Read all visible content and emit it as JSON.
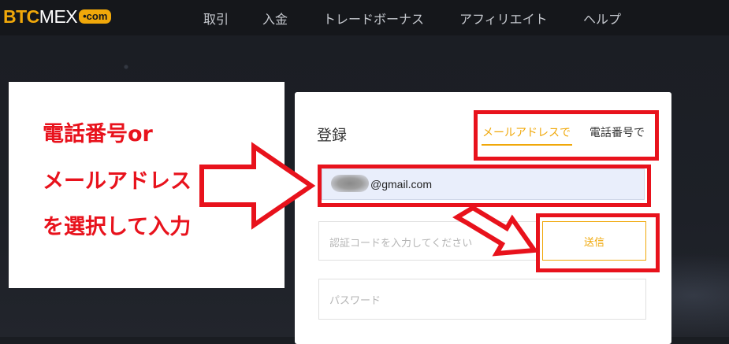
{
  "logo": {
    "btc": "BTC",
    "mex": "MEX",
    "com": "•com"
  },
  "nav": {
    "items": [
      {
        "label": "取引"
      },
      {
        "label": "入金"
      },
      {
        "label": "トレードボーナス"
      },
      {
        "label": "アフィリエイト"
      },
      {
        "label": "ヘルプ"
      }
    ]
  },
  "annotation": {
    "lines": [
      "電話番号or",
      "メールアドレス",
      "を選択して入力"
    ]
  },
  "form": {
    "title": "登録",
    "tabs": [
      {
        "label": "メールアドレスで",
        "active": true
      },
      {
        "label": "電話番号で",
        "active": false
      }
    ],
    "email_value": "@gmail.com",
    "code_placeholder": "認証コードを入力してください",
    "send_label": "送信",
    "password_placeholder": "パスワード"
  },
  "colors": {
    "accent": "#f0a80a",
    "annotation_red": "#e8121c",
    "nav_bg": "#15171b"
  },
  "icons": [
    "logo-mark",
    "arrow-right-annotation",
    "arrow-down-right-annotation"
  ]
}
